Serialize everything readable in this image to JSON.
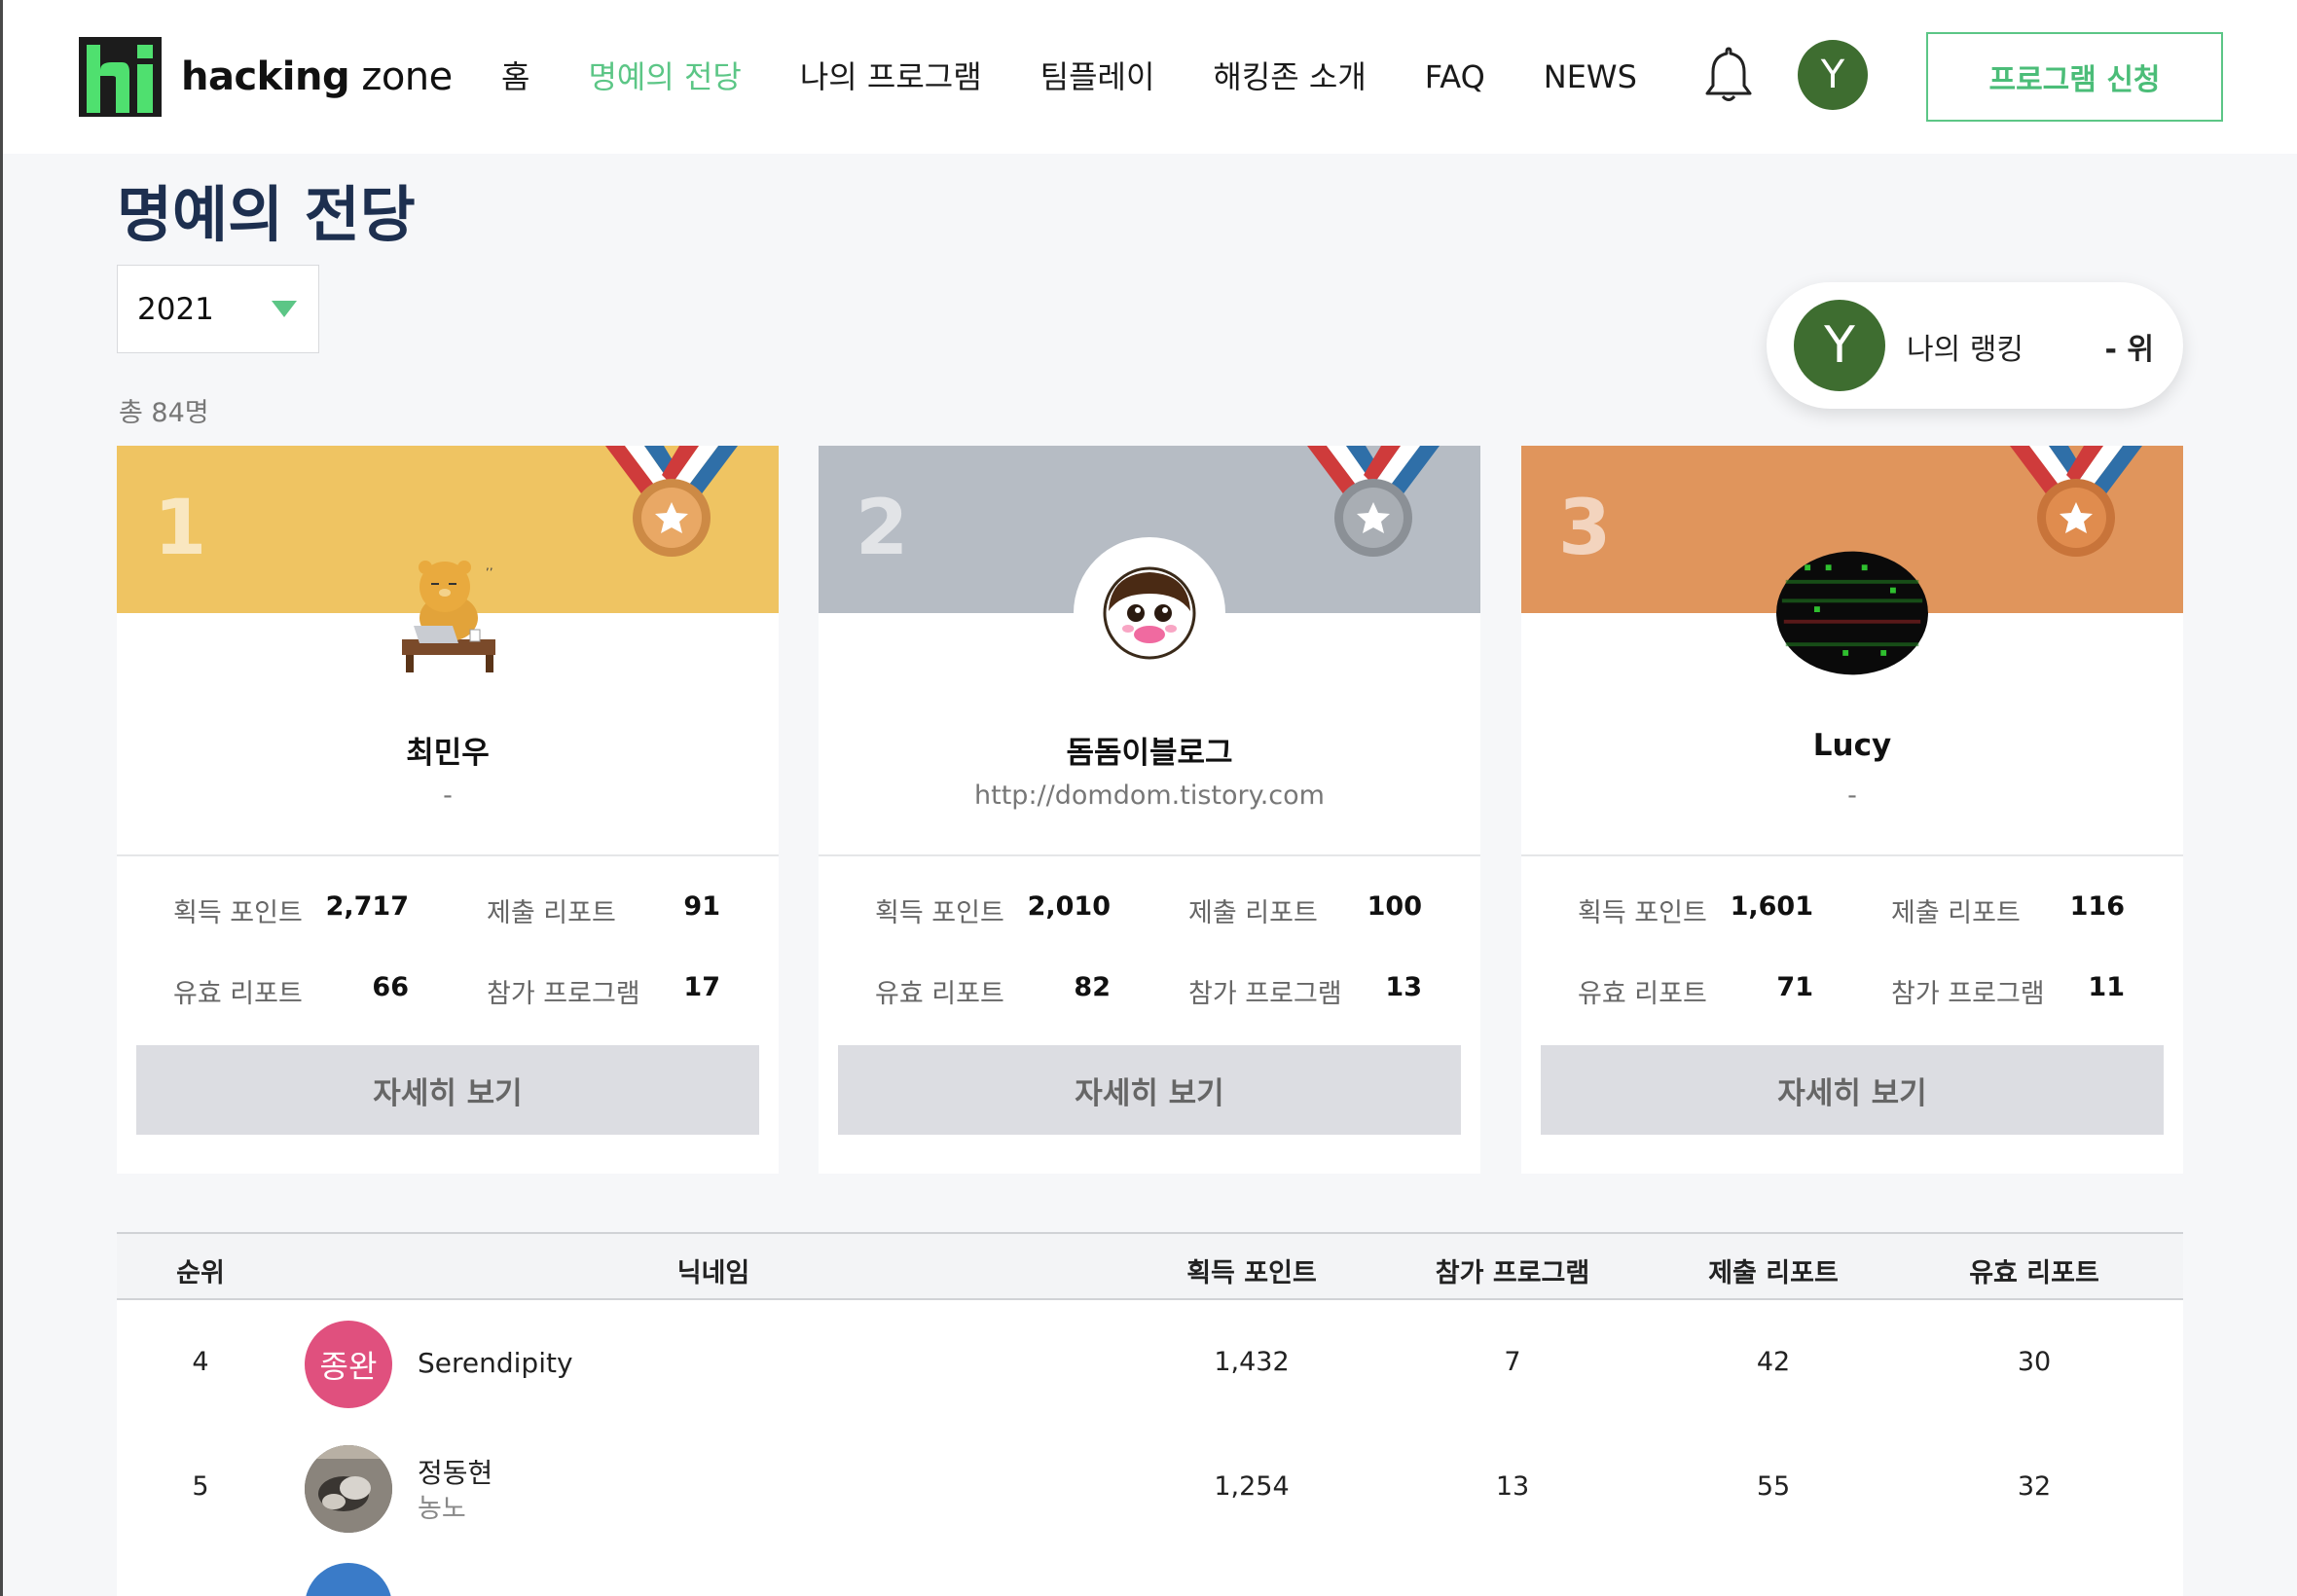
{
  "header": {
    "logo_bold": "hacking",
    "logo_light": " zone",
    "nav": [
      "홈",
      "명예의 전당",
      "나의 프로그램",
      "팀플레이",
      "해킹존 소개",
      "FAQ",
      "NEWS"
    ],
    "active_nav": "명예의 전당",
    "user_initial": "Y",
    "apply_label": "프로그램 신청"
  },
  "page": {
    "title": "명예의 전당",
    "year": "2021",
    "total": "총 84명"
  },
  "my_rank": {
    "initial": "Y",
    "label": "나의 랭킹",
    "value": "- 위"
  },
  "top3": [
    {
      "rank": "1",
      "name": "최민우",
      "sub": "-",
      "points": "2,717",
      "reports": "91",
      "valid": "66",
      "programs": "17",
      "color": "#efc462",
      "medal_color": "#cd8a45"
    },
    {
      "rank": "2",
      "name": "돔돔이블로그",
      "sub": "http://domdom.tistory.com",
      "points": "2,010",
      "reports": "100",
      "valid": "82",
      "programs": "13",
      "color": "#b6bcc4",
      "medal_color": "#8b9096"
    },
    {
      "rank": "3",
      "name": "Lucy",
      "sub": "-",
      "points": "1,601",
      "reports": "116",
      "valid": "71",
      "programs": "11",
      "color": "#e0955c",
      "medal_color": "#c8743a"
    }
  ],
  "stat_labels": {
    "points": "획득 포인트",
    "reports": "제출 리포트",
    "valid": "유효 리포트",
    "programs": "참가 프로그램"
  },
  "detail_label": "자세히 보기",
  "table": {
    "headers": [
      "순위",
      "닉네임",
      "획득 포인트",
      "참가 프로그램",
      "제출 리포트",
      "유효 리포트"
    ],
    "rows": [
      {
        "rank": "4",
        "avatar_text": "종완",
        "name": "Serendipity",
        "sub": "",
        "points": "1,432",
        "programs": "7",
        "reports": "42",
        "valid": "30"
      },
      {
        "rank": "5",
        "avatar_text": "",
        "name": "정동현",
        "sub": "농노",
        "points": "1,254",
        "programs": "13",
        "reports": "55",
        "valid": "32"
      }
    ]
  }
}
